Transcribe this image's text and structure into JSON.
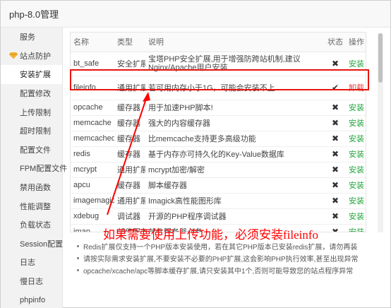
{
  "window": {
    "title": "php-8.0管理"
  },
  "sidebar": {
    "items": [
      {
        "label": "服务",
        "icon": ""
      },
      {
        "label": "站点防护",
        "icon": "diamond-icon"
      },
      {
        "label": "安装扩展",
        "icon": "",
        "active": true
      },
      {
        "label": "配置修改",
        "icon": ""
      },
      {
        "label": "上传限制",
        "icon": ""
      },
      {
        "label": "超时限制",
        "icon": ""
      },
      {
        "label": "配置文件",
        "icon": ""
      },
      {
        "label": "FPM配置文件",
        "icon": ""
      },
      {
        "label": "禁用函数",
        "icon": ""
      },
      {
        "label": "性能调整",
        "icon": ""
      },
      {
        "label": "负载状态",
        "icon": ""
      },
      {
        "label": "Session配置",
        "icon": ""
      },
      {
        "label": "日志",
        "icon": ""
      },
      {
        "label": "慢日志",
        "icon": ""
      },
      {
        "label": "phpinfo",
        "icon": ""
      }
    ]
  },
  "table": {
    "headers": {
      "name": "名称",
      "type": "类型",
      "desc": "说明",
      "status": "状态",
      "op": "操作"
    },
    "rows": [
      {
        "name": "bt_safe",
        "type": "安全扩展",
        "desc": "宝塔PHP安全扩展,用于增强防跨站机制,建议Nginx/Apache用户安装",
        "status": "x",
        "op": "安装"
      },
      {
        "name": "fileinfo",
        "type": "通用扩展",
        "desc": "若可用内存小于1G，可能会安装不上",
        "status": "ok",
        "op": "卸载"
      },
      {
        "name": "opcache",
        "type": "缓存器",
        "desc": "用于加速PHP脚本!",
        "status": "x",
        "op": "安装"
      },
      {
        "name": "memcache",
        "type": "缓存器",
        "desc": "强大的内容缓存器",
        "status": "x",
        "op": "安装"
      },
      {
        "name": "memcached",
        "type": "缓存器",
        "desc": "比memcache支持更多高级功能",
        "status": "x",
        "op": "安装"
      },
      {
        "name": "redis",
        "type": "缓存器",
        "desc": "基于内存亦可持久化的Key-Value数据库",
        "status": "x",
        "op": "安装"
      },
      {
        "name": "mcrypt",
        "type": "通用扩展",
        "desc": "mcrypt加密/解密",
        "status": "x",
        "op": "安装"
      },
      {
        "name": "apcu",
        "type": "缓存器",
        "desc": "脚本缓存器",
        "status": "x",
        "op": "安装"
      },
      {
        "name": "imagemagick",
        "type": "通用扩展",
        "desc": "Imagick高性能图形库",
        "status": "x",
        "op": "安装"
      },
      {
        "name": "xdebug",
        "type": "调试器",
        "desc": "开源的PHP程序调试器",
        "status": "x",
        "op": "安装"
      },
      {
        "name": "imap",
        "type": "邮件服务",
        "desc": "邮件服务器必备",
        "status": "x",
        "op": "安装"
      }
    ]
  },
  "annotation": {
    "text": "如果需要使用上传功能，必须安装fileinfo",
    "color": "#ff0000"
  },
  "notes": [
    "Redis扩展仅支持一个PHP版本安装使用，若在其它PHP版本已安装redis扩展，请勿再装",
    "请按实际需求安装扩展,不要安装不必要的PHP扩展,这会影响PHP执行效率,甚至出现异常",
    "opcache/xcache/apc等脚本缓存扩展,请只安装其中1个,否则可能导致您的站点程序异常"
  ],
  "colors": {
    "install": "#20a53a",
    "uninstall": "#e4393c",
    "highlight": "#e8140d"
  }
}
